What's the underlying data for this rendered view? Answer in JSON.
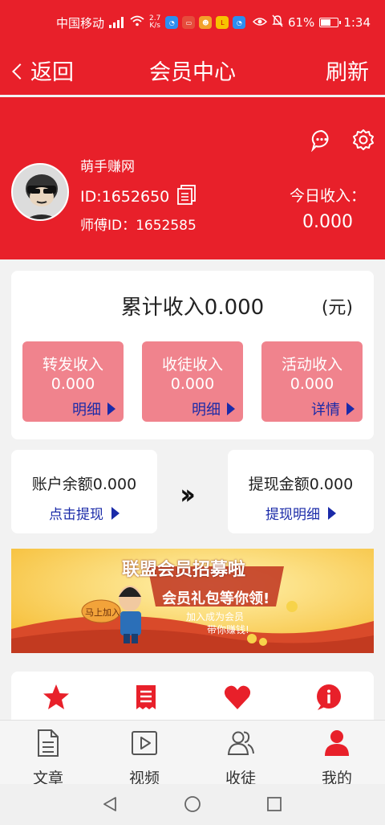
{
  "status_bar": {
    "carrier": "中国移动",
    "network": "4G",
    "speed_value": "2.7",
    "speed_unit": "K/s",
    "battery": "61%",
    "battery_level": 0.61,
    "time": "1:34"
  },
  "nav": {
    "back_label": "返回",
    "title": "会员中心",
    "refresh_label": "刷新"
  },
  "profile": {
    "name": "萌手赚网",
    "user_id": "ID:1652650",
    "master_id": "师傅ID：1652585",
    "today_label": "今日收入：",
    "today_value": "0.000"
  },
  "total": {
    "label": "累计收入0.000",
    "unit": "(元)"
  },
  "tiles": [
    {
      "title": "转发收入",
      "value": "0.000",
      "link": "明细"
    },
    {
      "title": "收徒收入",
      "value": "0.000",
      "link": "明细"
    },
    {
      "title": "活动收入",
      "value": "0.000",
      "link": "详情"
    }
  ],
  "balance": {
    "account_label": "账户余额0.000",
    "withdraw_action": "点击提现",
    "withdrawn_label": "提现金额0.000",
    "withdraw_detail": "提现明细"
  },
  "banner": {
    "headline": "联盟会员招募啦",
    "subline": "会员礼包等你领!",
    "line3": "加入成为会员",
    "line4": "带你赚钱!",
    "bubble": "马上加入"
  },
  "icon_row": {
    "icons": [
      "star-icon",
      "receipt-icon",
      "heart-icon",
      "info-icon"
    ]
  },
  "tabs": [
    {
      "label": "文章",
      "icon": "document-icon"
    },
    {
      "label": "视频",
      "icon": "video-icon"
    },
    {
      "label": "收徒",
      "icon": "users-icon"
    },
    {
      "label": "我的",
      "icon": "profile-icon"
    }
  ],
  "colors": {
    "brand_red": "#e8202a",
    "tile_pink": "#f0838d",
    "link_blue": "#1a2aa8"
  }
}
